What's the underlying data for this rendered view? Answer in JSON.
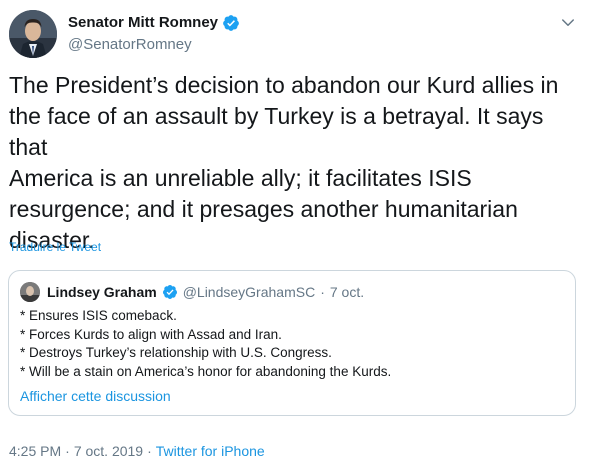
{
  "tweet": {
    "author": {
      "display_name": "Senator Mitt Romney",
      "handle": "@SenatorRomney",
      "verified": true
    },
    "text": "The President’s decision to abandon our Kurd allies in\nthe face of an assault by Turkey is a betrayal. It says that\nAmerica is an unreliable ally; it facilitates ISIS\nresurgence; and it presages another humanitarian\ndisaster.",
    "translate_label": "Traduire le Tweet",
    "quoted": {
      "display_name": "Lindsey Graham",
      "handle": "@LindseyGrahamSC",
      "separator": "·",
      "date": "7 oct.",
      "verified": true,
      "lines": [
        "* Ensures ISIS comeback.",
        "* Forces Kurds to align with Assad and Iran.",
        "* Destroys Turkey’s relationship with U.S. Congress.",
        "* Will be a stain on America’s honor for abandoning the Kurds."
      ],
      "show_thread_label": "Afficher cette discussion"
    },
    "meta": {
      "time": "4:25 PM",
      "separator_1": "·",
      "date": "7 oct. 2019",
      "separator_2": "·",
      "source": "Twitter for iPhone"
    }
  },
  "icons": {
    "verified": "verified-badge-icon",
    "menu": "chevron-down-icon"
  },
  "colors": {
    "link": "#1b95e0",
    "verified": "#1da1f2",
    "secondary_text": "#657786",
    "border": "#ccd6dd"
  }
}
